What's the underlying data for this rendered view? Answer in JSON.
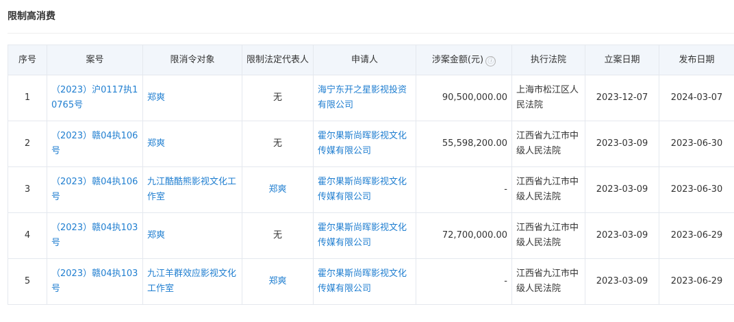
{
  "section": {
    "title": "限制高消费"
  },
  "table": {
    "headers": {
      "num": "序号",
      "case": "案号",
      "target": "限消令对象",
      "legal_rep": "限制法定代表人",
      "applicant": "申请人",
      "amount": "涉案金额(元)",
      "court": "执行法院",
      "filing_date": "立案日期",
      "publish_date": "发布日期"
    },
    "amount_info_icon": "ⓘ",
    "rows": [
      {
        "num": "1",
        "case": "（2023）沪0117执10765号",
        "target": "郑爽",
        "legal_rep": "无",
        "applicant": "海宁东开之星影视投资有限公司",
        "amount": "90,500,000.00",
        "court": "上海市松江区人民法院",
        "filing_date": "2023-12-07",
        "publish_date": "2024-03-07"
      },
      {
        "num": "2",
        "case": "（2023）赣04执106号",
        "target": "郑爽",
        "legal_rep": "无",
        "applicant": "霍尔果斯尚晖影视文化传媒有限公司",
        "amount": "55,598,200.00",
        "court": "江西省九江市中级人民法院",
        "filing_date": "2023-03-09",
        "publish_date": "2023-06-30"
      },
      {
        "num": "3",
        "case": "（2023）赣04执106号",
        "target": "九江酷酷熊影视文化工作室",
        "legal_rep": "郑爽",
        "applicant": "霍尔果斯尚晖影视文化传媒有限公司",
        "amount": "-",
        "court": "江西省九江市中级人民法院",
        "filing_date": "2023-03-09",
        "publish_date": "2023-06-30"
      },
      {
        "num": "4",
        "case": "（2023）赣04执103号",
        "target": "郑爽",
        "legal_rep": "无",
        "applicant": "霍尔果斯尚晖影视文化传媒有限公司",
        "amount": "72,700,000.00",
        "court": "江西省九江市中级人民法院",
        "filing_date": "2023-03-09",
        "publish_date": "2023-06-29"
      },
      {
        "num": "5",
        "case": "（2023）赣04执103号",
        "target": "九江羊群效应影视文化工作室",
        "legal_rep": "郑爽",
        "applicant": "霍尔果斯尚晖影视文化传媒有限公司",
        "amount": "-",
        "court": "江西省九江市中级人民法院",
        "filing_date": "2023-03-09",
        "publish_date": "2023-06-29"
      }
    ]
  }
}
